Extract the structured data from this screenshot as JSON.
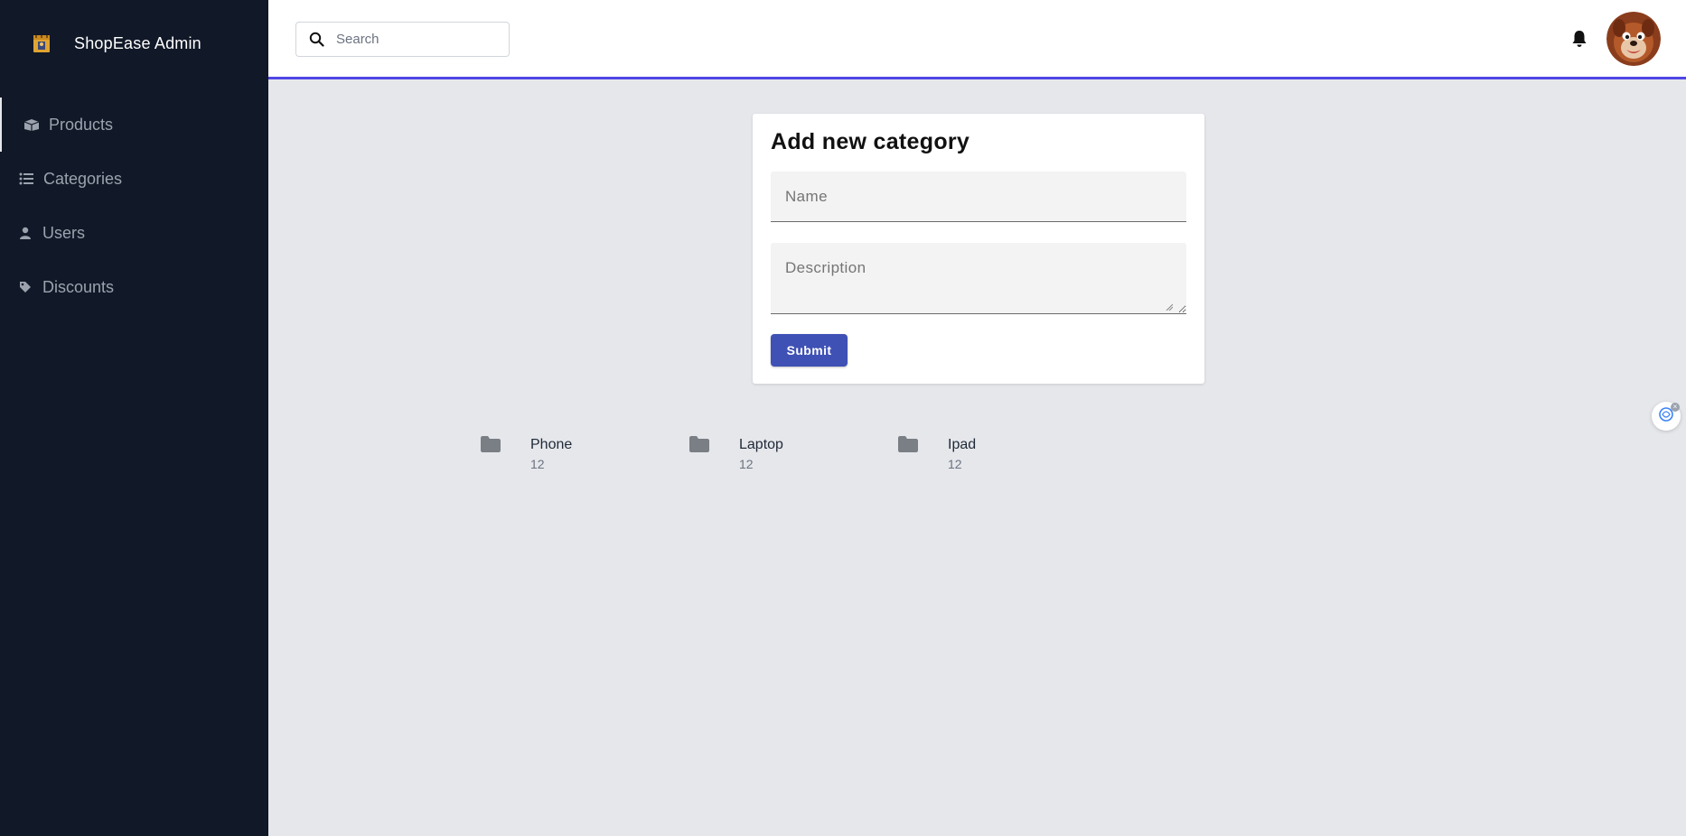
{
  "brand": {
    "title": "ShopEase Admin",
    "logo_icon": "shop-logo-icon"
  },
  "sidebar": {
    "items": [
      {
        "label": "Products",
        "icon": "box-icon",
        "active": true
      },
      {
        "label": "Categories",
        "icon": "list-icon",
        "active": false
      },
      {
        "label": "Users",
        "icon": "user-icon",
        "active": false
      },
      {
        "label": "Discounts",
        "icon": "tag-icon",
        "active": false
      }
    ]
  },
  "header": {
    "search_placeholder": "Search",
    "notification_icon": "bell-icon",
    "avatar_icon": "avatar"
  },
  "form": {
    "title": "Add new category",
    "name_placeholder": "Name",
    "name_value": "",
    "description_placeholder": "Description",
    "description_value": "",
    "submit_label": "Submit"
  },
  "categories": [
    {
      "name": "Phone",
      "count": "12"
    },
    {
      "name": "Laptop",
      "count": "12"
    },
    {
      "name": "Ipad",
      "count": "12"
    }
  ],
  "colors": {
    "sidebar_bg": "#111827",
    "accent": "#4f46e5",
    "button": "#3f51b5",
    "page_bg": "#e5e7eb"
  }
}
